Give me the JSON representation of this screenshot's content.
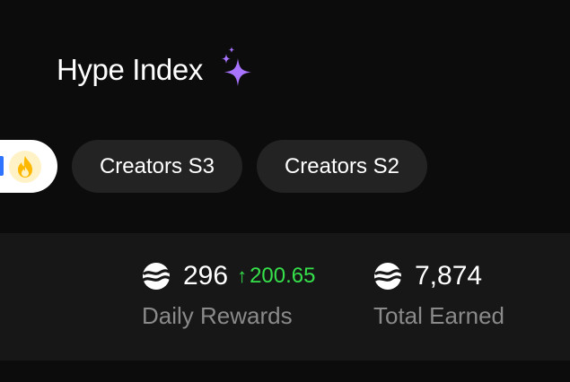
{
  "header": {
    "title": "Hype Index",
    "sparkle_icon": "sparkles-icon",
    "sparkle_color": "#a874ff"
  },
  "tabs": [
    {
      "label": "",
      "icon": "flame-icon",
      "active": true
    },
    {
      "label": "Creators S3",
      "active": false
    },
    {
      "label": "Creators S2",
      "active": false
    }
  ],
  "stats": {
    "daily": {
      "icon": "coin-icon",
      "value": "296",
      "change": "200.65",
      "change_direction": "up",
      "label": "Daily Rewards"
    },
    "total": {
      "icon": "coin-icon",
      "value": "7,874",
      "label": "Total Earned"
    }
  },
  "colors": {
    "background": "#0c0c0c",
    "stats_band": "#171717",
    "tab_bg": "#232323",
    "positive": "#35e04a",
    "muted": "#8a8a8a",
    "accent_blue": "#2d73ff",
    "flame": "#ffb800"
  }
}
